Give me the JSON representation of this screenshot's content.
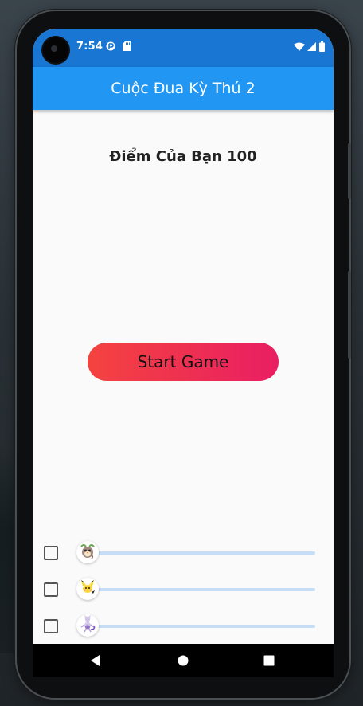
{
  "status_bar": {
    "time": "7:54",
    "left_icons": [
      "media-icon",
      "sd-card-icon"
    ],
    "right_icons": [
      "wifi-icon",
      "signal-icon",
      "battery-icon"
    ]
  },
  "app_bar": {
    "title": "Cuộc Đua Kỳ Thú 2"
  },
  "score": {
    "text": "Điểm Của Bạn 100"
  },
  "start_button": {
    "label": "Start Game"
  },
  "racers": [
    {
      "name": "racer-1",
      "checked": false,
      "progress": 0.0,
      "avatar_icon": "pokemon-rowlet-icon",
      "avatar_color": "#a1887f"
    },
    {
      "name": "racer-2",
      "checked": false,
      "progress": 0.0,
      "avatar_icon": "pokemon-pichu-icon",
      "avatar_color": "#f9d835"
    },
    {
      "name": "racer-3",
      "checked": false,
      "progress": 0.0,
      "avatar_icon": "pokemon-mewtwo-icon",
      "avatar_color": "#b39ddb"
    }
  ],
  "nav_bar": {
    "items": [
      "back-icon",
      "home-icon",
      "recents-icon"
    ]
  },
  "colors": {
    "status_bar": "#1976d2",
    "app_bar": "#2196f3",
    "button_gradient_start": "#f4433f",
    "button_gradient_end": "#e91e63",
    "slider_track": "#c5def6"
  }
}
